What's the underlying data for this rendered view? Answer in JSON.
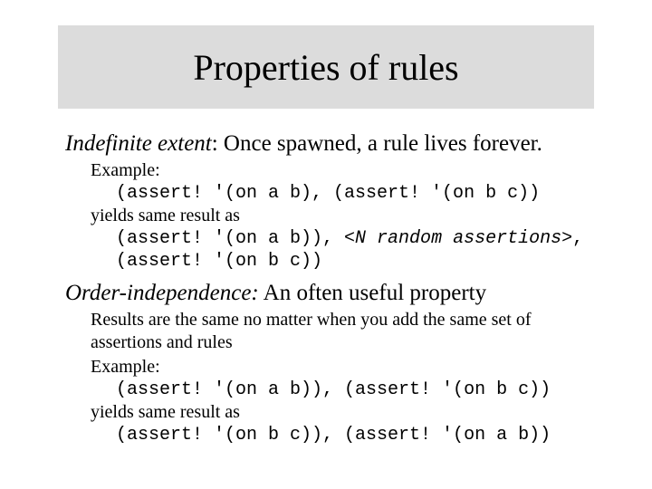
{
  "title": "Properties of rules",
  "section1": {
    "lead_em": "Indefinite extent",
    "lead_rest": ": Once spawned, a rule lives forever.",
    "example_label": "Example:",
    "code1": "(assert! '(on a b), (assert! '(on b c))",
    "yields": "yields same result as",
    "code2a": "(assert! '(on a b)), ",
    "code2b": "<N random assertions>",
    "code2c": ", (assert! '(on b c))"
  },
  "section2": {
    "lead_em": "Order-independence:",
    "lead_rest": "  An often useful property",
    "desc": "Results are the same no matter when you add the same set of assertions and rules",
    "example_label": "Example:",
    "code1": "(assert! '(on a b)), (assert! '(on b c))",
    "yields": "yields same result as",
    "code2": "(assert! '(on b c)), (assert! '(on a b))"
  }
}
